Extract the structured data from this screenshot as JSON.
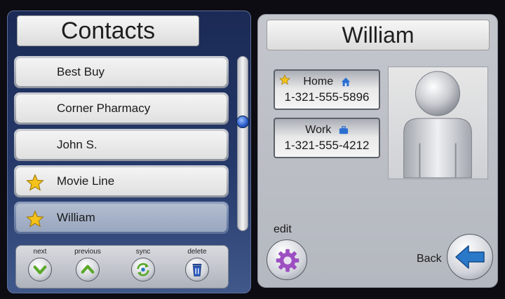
{
  "contacts_panel": {
    "title": "Contacts",
    "items": [
      {
        "label": "Best Buy",
        "favorite": false,
        "selected": false
      },
      {
        "label": "Corner Pharmacy",
        "favorite": false,
        "selected": false
      },
      {
        "label": "John S.",
        "favorite": false,
        "selected": false
      },
      {
        "label": "Movie Line",
        "favorite": true,
        "selected": false
      },
      {
        "label": "William",
        "favorite": true,
        "selected": true
      }
    ],
    "toolbar": {
      "next_label": "next",
      "previous_label": "previous",
      "sync_label": "sync",
      "delete_label": "delete"
    }
  },
  "detail_panel": {
    "name": "William",
    "phones": [
      {
        "type": "Home",
        "number": "1-321-555-5896",
        "favorite": true,
        "icon": "house-icon"
      },
      {
        "type": "Work",
        "number": "1-321-555-4212",
        "favorite": false,
        "icon": "briefcase-icon"
      }
    ],
    "edit_label": "edit",
    "back_label": "Back"
  },
  "colors": {
    "panel_blue": "#25396a",
    "star_gold": "#f5c21b",
    "accent_blue": "#2a78c8",
    "gear_purple": "#9d4fc2"
  }
}
